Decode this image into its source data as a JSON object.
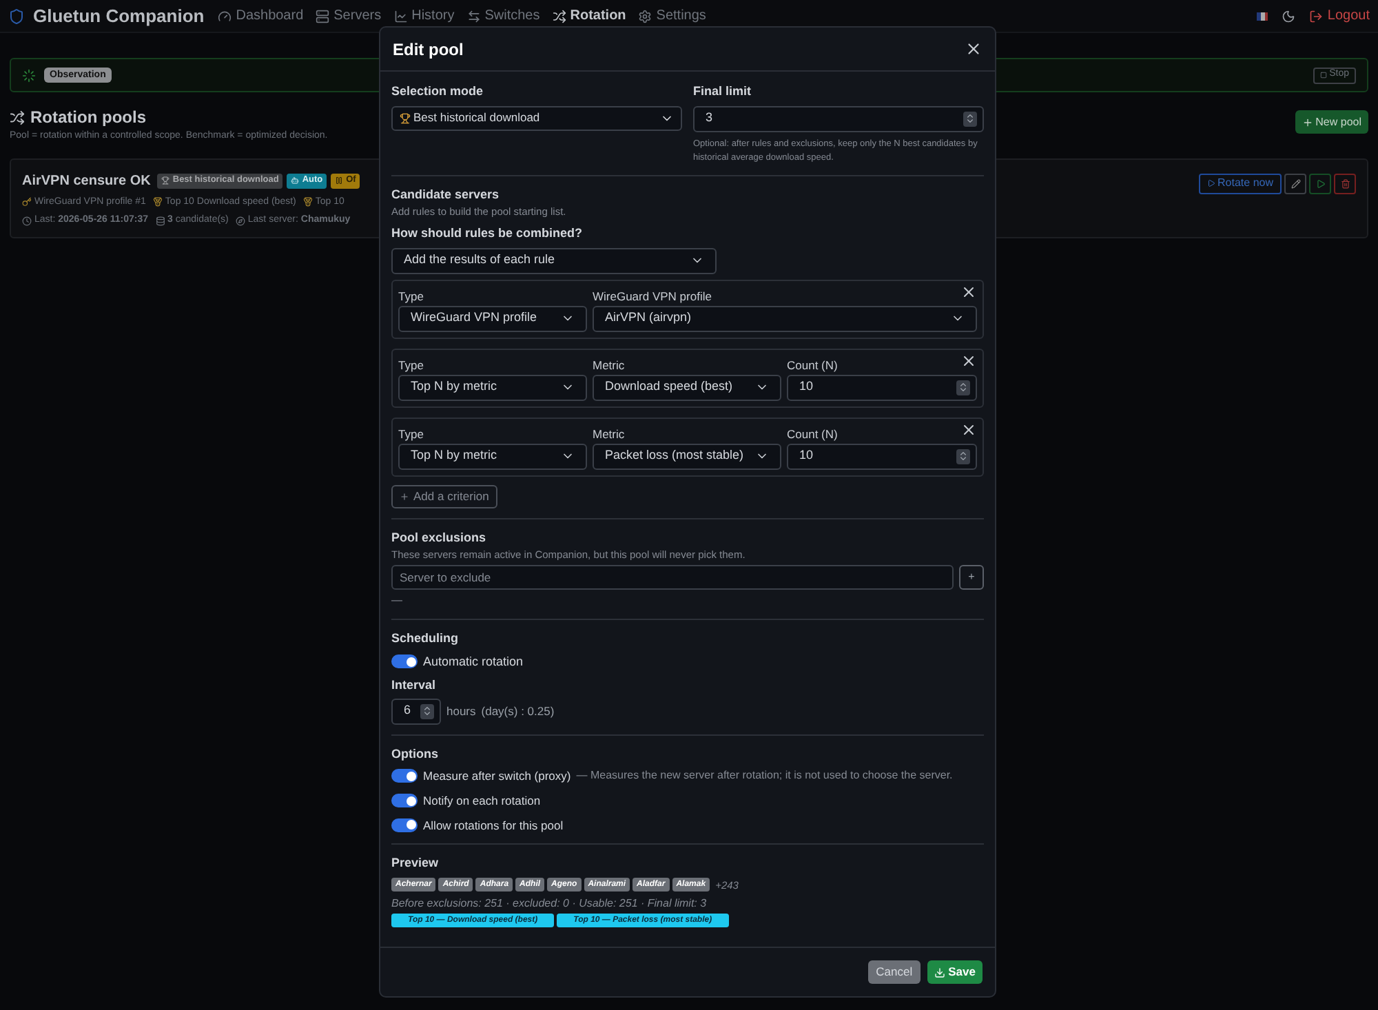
{
  "nav": {
    "brand": "Gluetun Companion",
    "items": [
      {
        "label": "Dashboard",
        "selected": false
      },
      {
        "label": "Servers",
        "selected": false
      },
      {
        "label": "History",
        "selected": false
      },
      {
        "label": "Switches",
        "selected": false
      },
      {
        "label": "Rotation",
        "selected": true
      },
      {
        "label": "Settings",
        "selected": false
      }
    ],
    "logout": "Logout"
  },
  "status": {
    "badge": "Observation",
    "stop": "Stop"
  },
  "page": {
    "title": "Rotation pools",
    "subtitle": "Pool = rotation within a controlled scope. Benchmark = optimized decision.",
    "new_pool": "New pool"
  },
  "pool_card": {
    "name": "AirVPN censure OK",
    "badges": [
      {
        "label": "Best historical download",
        "color": "#3b3d40"
      },
      {
        "label": "Auto",
        "color": "#0e7d92"
      },
      {
        "label": "Of",
        "color": "#a17a0b"
      }
    ],
    "meta": [
      "WireGuard VPN profile #1",
      "Top 10 Download speed (best)",
      "Top 10"
    ],
    "info": [
      "Last: **2026-05-26 11:07:37**",
      "**3** candidate(s)",
      "Last server: **Chamukuy**"
    ],
    "rotate": "Rotate now"
  },
  "modal": {
    "title": "Edit pool",
    "selection_mode": {
      "label": "Selection mode",
      "value": "Best historical download"
    },
    "final_limit": {
      "label": "Final limit",
      "value": "3",
      "hint": "Optional: after rules and exclusions, keep only the N best candidates by historical average download speed."
    },
    "candidates": {
      "title": "Candidate servers",
      "hint": "Add rules to build the pool starting list.",
      "combine_label": "How should rules be combined?",
      "combine_value": "Add the results of each rule",
      "rules": [
        {
          "fields": [
            {
              "kind": "select",
              "label": "Type",
              "value": "WireGuard VPN profile"
            },
            {
              "kind": "select",
              "label": "WireGuard VPN profile",
              "value": "AirVPN (airvpn)"
            }
          ]
        },
        {
          "fields": [
            {
              "kind": "select",
              "label": "Type",
              "value": "Top N by metric"
            },
            {
              "kind": "select",
              "label": "Metric",
              "value": "Download speed (best)"
            },
            {
              "kind": "number",
              "label": "Count (N)",
              "value": "10"
            }
          ]
        },
        {
          "fields": [
            {
              "kind": "select",
              "label": "Type",
              "value": "Top N by metric"
            },
            {
              "kind": "select",
              "label": "Metric",
              "value": "Packet loss (most stable)"
            },
            {
              "kind": "number",
              "label": "Count (N)",
              "value": "10"
            }
          ]
        }
      ],
      "add": "Add a criterion"
    },
    "exclusions": {
      "title": "Pool exclusions",
      "hint": "These servers remain active in Companion, but this pool will never pick them.",
      "placeholder": "Server to exclude",
      "add": "+",
      "empty": "—"
    },
    "scheduling": {
      "title": "Scheduling",
      "toggle": {
        "label": "Automatic rotation",
        "on": true
      },
      "interval_label": "Interval",
      "interval_value": "6",
      "unit": "hours",
      "days": "(day(s) : 0.25)"
    },
    "options": {
      "title": "Options",
      "toggles": [
        {
          "label": "Measure after switch (proxy)",
          "note": "— Measures the new server after rotation; it is not used to choose the server.",
          "on": true
        },
        {
          "label": "Notify on each rotation",
          "on": true
        },
        {
          "label": "Allow rotations for this pool",
          "on": true
        }
      ]
    },
    "preview": {
      "title": "Preview",
      "chips": [
        "Achernar",
        "Achird",
        "Adhara",
        "Adhil",
        "Ageno",
        "Ainalrami",
        "Aladfar",
        "Alamak"
      ],
      "more": "+243",
      "stats": "Before exclusions: 251 · excluded: 0 · Usable: 251 · Final limit: 3",
      "rule_chips": [
        "Top 10 — Download speed (best)",
        "Top 10 — Packet loss (most stable)"
      ]
    },
    "cancel": "Cancel",
    "save": "Save"
  }
}
